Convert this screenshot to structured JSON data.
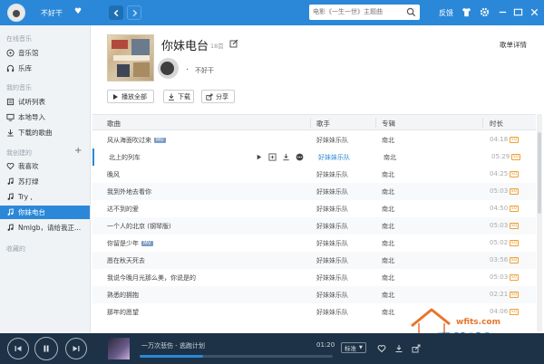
{
  "topbar": {
    "username": "不好干",
    "search_placeholder": "电影《一生一世》主题曲",
    "feedback": "反馈"
  },
  "sidebar": {
    "sections": {
      "online": "在线音乐",
      "mine": "我的音乐",
      "created": "我创建的",
      "collected": "收藏的"
    },
    "online_items": [
      {
        "label": "音乐馆",
        "icon": "disc-icon"
      },
      {
        "label": "乐库",
        "icon": "headphones-icon"
      }
    ],
    "my_items": [
      {
        "label": "试听列表",
        "icon": "list-icon"
      },
      {
        "label": "本地导入",
        "icon": "monitor-icon"
      },
      {
        "label": "下载的歌曲",
        "icon": "download-icon"
      }
    ],
    "created_items": [
      {
        "label": "我喜欢",
        "icon": "heart-icon"
      },
      {
        "label": "苏打绿",
        "icon": "note-icon"
      },
      {
        "label": "Try ,",
        "icon": "note-icon"
      },
      {
        "label": "你妹电台",
        "icon": "note-icon",
        "active": true
      },
      {
        "label": "Nmlgb，请给我正...",
        "icon": "note-icon"
      }
    ]
  },
  "playlist": {
    "title": "你妹电台",
    "count": "18首",
    "detail_link": "歌单详情",
    "owner_dot": ".",
    "owner": "不好干",
    "buttons": {
      "play_all": "播放全部",
      "download": "下载",
      "share": "分享"
    }
  },
  "table": {
    "headers": {
      "song": "歌曲",
      "artist": "歌手",
      "album": "专辑",
      "duration": "时长"
    },
    "rows": [
      {
        "song": "风从海面吹过来",
        "mv": "MV",
        "artist": "好妹妹乐队",
        "album": "南北",
        "duration": "04:18"
      },
      {
        "song": "北上的列车",
        "mv": "",
        "artist": "好妹妹乐队",
        "album": "南北",
        "duration": "05:29"
      },
      {
        "song": "晚风",
        "mv": "",
        "artist": "好妹妹乐队",
        "album": "南北",
        "duration": "04:25"
      },
      {
        "song": "我到外地去看你",
        "mv": "",
        "artist": "好妹妹乐队",
        "album": "南北",
        "duration": "05:03"
      },
      {
        "song": "达不到的爱",
        "mv": "",
        "artist": "好妹妹乐队",
        "album": "南北",
        "duration": "04:50"
      },
      {
        "song": "一个人的北京 (钢琴版)",
        "mv": "",
        "artist": "好妹妹乐队",
        "album": "南北",
        "duration": "05:03"
      },
      {
        "song": "你留是少年",
        "mv": "MV",
        "artist": "好妹妹乐队",
        "album": "南北",
        "duration": "05:02"
      },
      {
        "song": "愿在秋天死去",
        "mv": "",
        "artist": "好妹妹乐队",
        "album": "南北",
        "duration": "03:56"
      },
      {
        "song": "我说今晚月光那么美，你说是的",
        "mv": "",
        "artist": "好妹妹乐队",
        "album": "南北",
        "duration": "05:03"
      },
      {
        "song": "熟悉的拥抱",
        "mv": "",
        "artist": "好妹妹乐队",
        "album": "南北",
        "duration": "02:21"
      },
      {
        "song": "那年的愿望",
        "mv": "",
        "artist": "好妹妹乐队",
        "album": "南北",
        "duration": "04:06"
      }
    ],
    "quality_badge": "SQ"
  },
  "player": {
    "now_playing": "一万次悲伤 - 逃跑计划",
    "elapsed": "01:20",
    "progress": 0.33,
    "quality": "标准"
  },
  "watermark": {
    "url": "wfits.com",
    "text": "潍坊论坛"
  },
  "colors": {
    "accent": "#2b88d8",
    "player_bg": "#1d3246",
    "sq_badge": "#f0a136"
  }
}
